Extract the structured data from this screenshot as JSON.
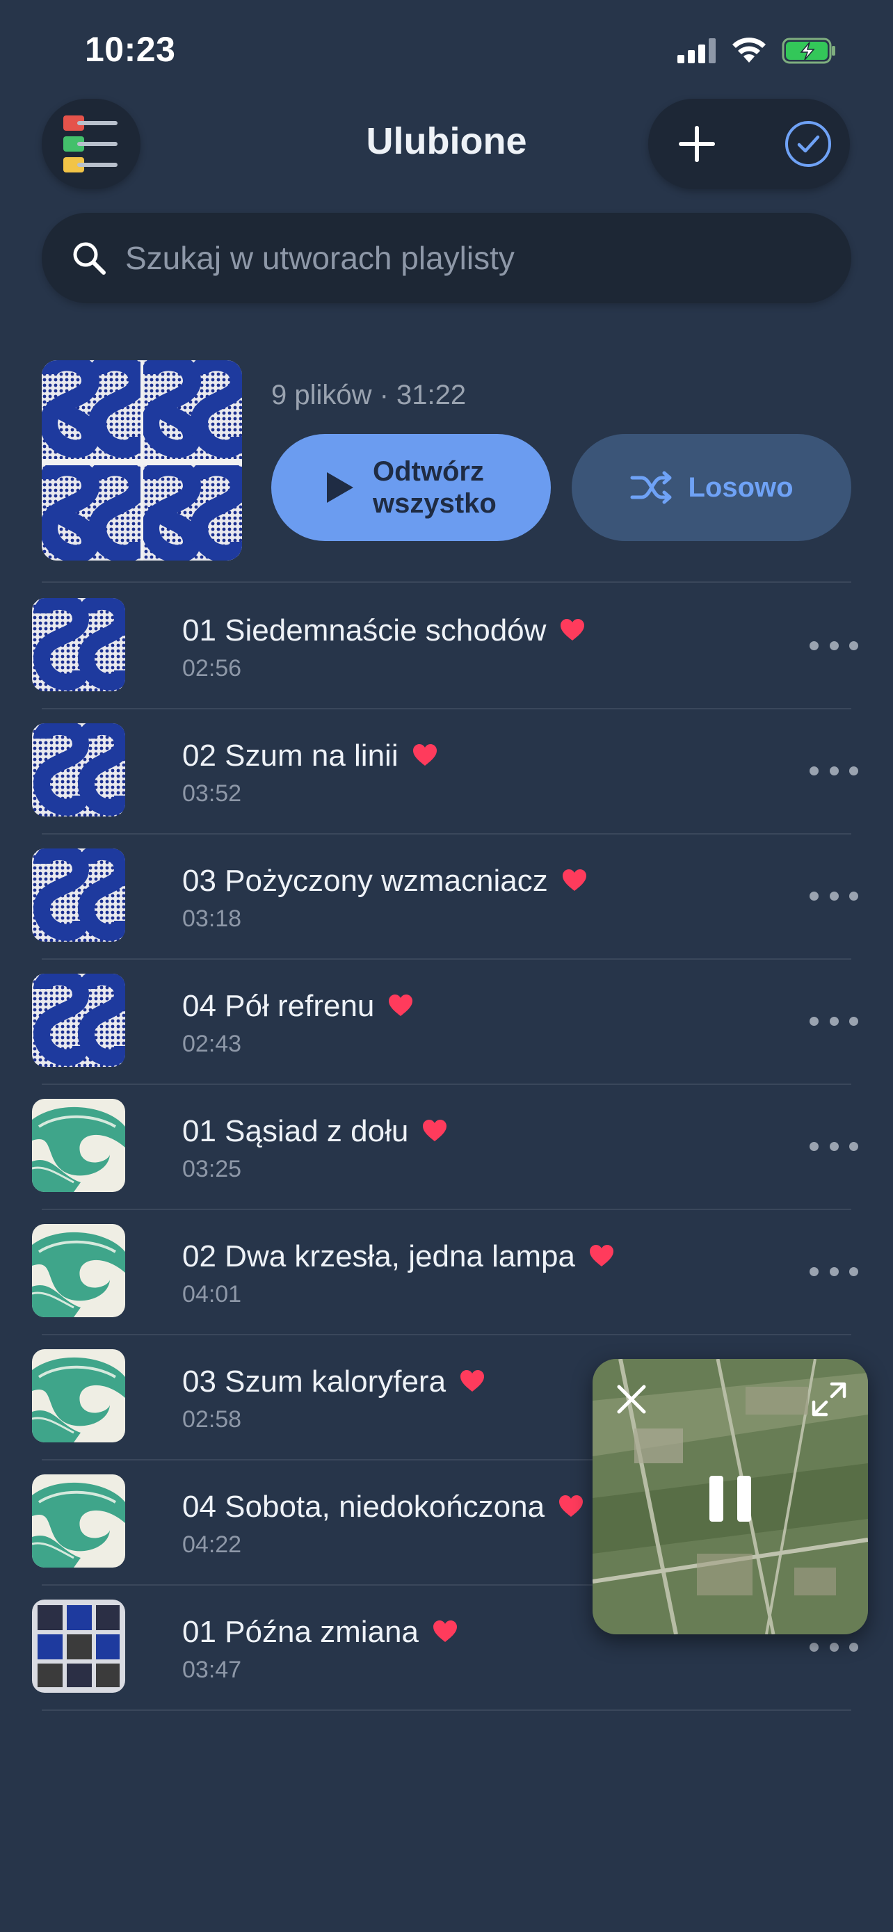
{
  "status_bar": {
    "time": "10:23",
    "icons": [
      "signal-icon",
      "wifi-icon",
      "battery-charging-icon"
    ]
  },
  "header": {
    "title": "Ulubione",
    "menu_icon": "colored-list-icon",
    "add_icon": "plus-icon",
    "select_icon": "check-circle-icon"
  },
  "search": {
    "placeholder": "Szukaj w utworach playlisty",
    "value": ""
  },
  "summary": {
    "meta": "9 plików · 31:22",
    "play_all_label": "Odtwórz wszystko",
    "shuffle_label": "Losowo"
  },
  "tracks": [
    {
      "title": "01 Siedemnaście schodów",
      "duration": "02:56",
      "favorite": true,
      "art": "blue-pattern"
    },
    {
      "title": "02 Szum na linii",
      "duration": "03:52",
      "favorite": true,
      "art": "blue-pattern"
    },
    {
      "title": "03 Pożyczony wzmacniacz",
      "duration": "03:18",
      "favorite": true,
      "art": "blue-pattern"
    },
    {
      "title": "04 Pół refrenu",
      "duration": "02:43",
      "favorite": true,
      "art": "blue-pattern"
    },
    {
      "title": "01 Sąsiad z dołu",
      "duration": "03:25",
      "favorite": true,
      "art": "green-wave"
    },
    {
      "title": "02 Dwa krzesła, jedna lampa",
      "duration": "04:01",
      "favorite": true,
      "art": "green-wave"
    },
    {
      "title": "03 Szum kaloryfera",
      "duration": "02:58",
      "favorite": true,
      "art": "green-wave"
    },
    {
      "title": "04 Sobota, niedokończona",
      "duration": "04:22",
      "favorite": true,
      "art": "green-wave"
    },
    {
      "title": "01 Późna zmiana",
      "duration": "03:47",
      "favorite": true,
      "art": "windows-grid"
    }
  ],
  "mini_player": {
    "state": "playing",
    "close_icon": "close-icon",
    "expand_icon": "expand-icon",
    "pause_icon": "pause-icon"
  },
  "colors": {
    "background": "#27354a",
    "accent": "#6b9cf0",
    "heart": "#ff3b5c"
  }
}
